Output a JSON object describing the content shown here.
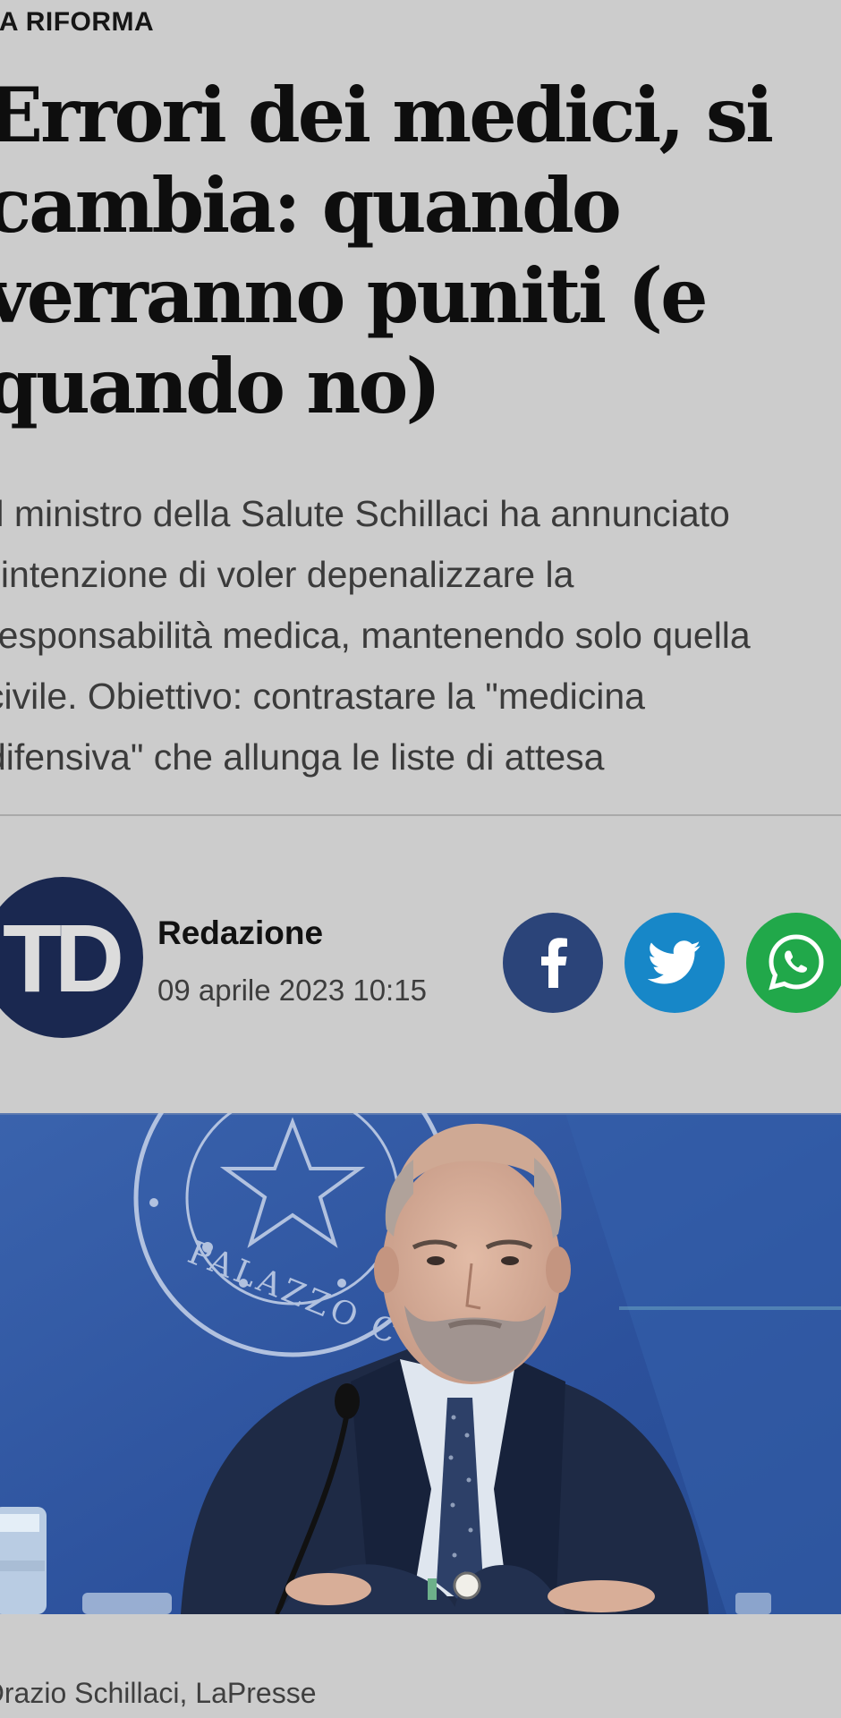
{
  "article": {
    "kicker": "LA RIFORMA",
    "headline_lines": [
      "Errori dei medici, si",
      "cambia: quando",
      "verranno puniti (e",
      "quando no)"
    ],
    "summary_lines": [
      "Il ministro della Salute Schillaci ha annunciato",
      "l'intenzione di voler depenalizzare la",
      "responsabilità medica, mantenendo solo quella",
      "civile. Obiettivo: contrastare la \"medicina",
      "difensiva\" che allunga le liste di attesa"
    ]
  },
  "author": {
    "avatar_initials": "TD",
    "name": "Redazione",
    "published": "09 aprile 2023 10:15"
  },
  "share": {
    "buttons": [
      {
        "name": "facebook",
        "icon": "facebook-icon",
        "color": "#2b4479"
      },
      {
        "name": "twitter",
        "icon": "twitter-icon",
        "color": "#1787c8"
      },
      {
        "name": "whatsapp",
        "icon": "whatsapp-icon",
        "color": "#21a84a"
      }
    ]
  },
  "photo": {
    "seal_text": "PALAZZO C",
    "caption": "Orazio Schillaci, LaPresse"
  },
  "colors": {
    "page_background": "#cccccc",
    "avatar_background": "#1a2850",
    "photo_background": "#2f55a0"
  }
}
